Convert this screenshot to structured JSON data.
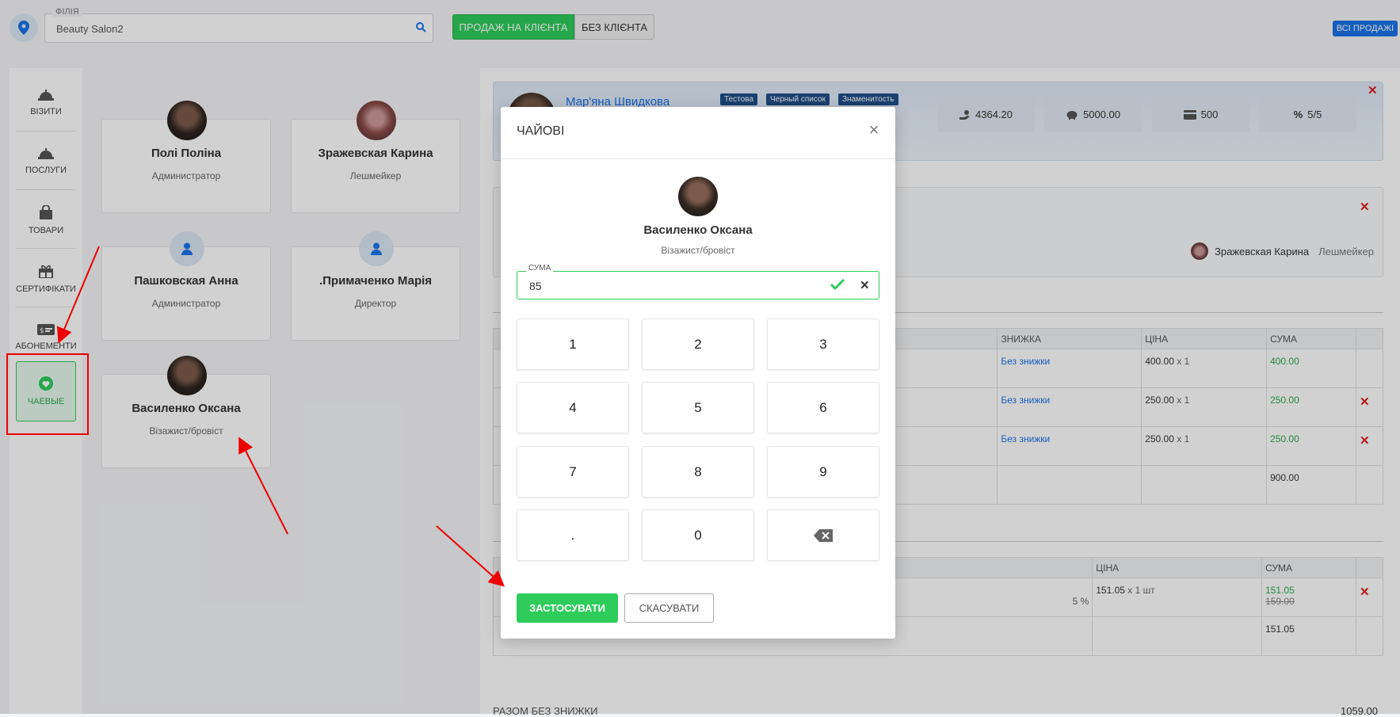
{
  "header": {
    "branch_label": "ФІЛІЯ",
    "branch_value": "Beauty Salon2",
    "sale_to_client": "ПРОДАЖ НА КЛІЄНТА",
    "no_client": "БЕЗ КЛІЄНТА",
    "all_sales": "ВСІ ПРОДАЖІ"
  },
  "sidebar": {
    "items": [
      {
        "label": "ВІЗИТИ",
        "icon": "bell-icon"
      },
      {
        "label": "ПОСЛУГИ",
        "icon": "bell-icon"
      },
      {
        "label": "ТОВАРИ",
        "icon": "bag-icon"
      },
      {
        "label": "СЕРТИФІКАТИ",
        "icon": "gift-icon"
      },
      {
        "label": "АБОНЕМЕНТИ",
        "icon": "ticket-icon"
      },
      {
        "label": "ЧАЕВЫЕ",
        "icon": "heart-icon",
        "active": true
      }
    ]
  },
  "staff": [
    {
      "name": "Полі Поліна",
      "role": "Администратор"
    },
    {
      "name": "Зражевская Карина",
      "role": "Лешмейкер"
    },
    {
      "name": "Пашковская Анна",
      "role": "Администратор"
    },
    {
      "name": ".Примаченко Марія",
      "role": "Директор"
    },
    {
      "name": "Василенко Оксана",
      "role": "Візажист/бровіст"
    }
  ],
  "client": {
    "name": "Мар'яна Швидкова",
    "tags": [
      "Тестова",
      "Черный список",
      "Знаменитость"
    ],
    "stats": [
      {
        "icon": "hand-coin-icon",
        "value": "4364.20"
      },
      {
        "icon": "piggy-bank-icon",
        "value": "5000.00"
      },
      {
        "icon": "card-icon",
        "value": "500"
      },
      {
        "icon": "percent-icon",
        "value": "5/5"
      }
    ]
  },
  "master": {
    "name": "Зражевская Карина",
    "role": "Лешмейкер"
  },
  "services_table": {
    "headers": [
      "ЗНИЖКА",
      "ЦІНА",
      "СУМА"
    ],
    "rows": [
      {
        "discount": "Без знижки",
        "price": "400.00",
        "qty": "x 1",
        "sum": "400.00"
      },
      {
        "discount": "Без знижки",
        "price": "250.00",
        "qty": "x 1",
        "sum": "250.00"
      },
      {
        "discount": "Без знижки",
        "price": "250.00",
        "qty": "x 1",
        "sum": "250.00"
      }
    ],
    "total": "900.00"
  },
  "goods_table": {
    "headers": [
      "ЦІНА",
      "СУМА"
    ],
    "row": {
      "price": "151.05",
      "qty": "x 1 шт",
      "sum": "151.05",
      "old_sum": "159.00",
      "discount_fragment": "5 %"
    },
    "total": "151.05"
  },
  "summary": {
    "label": "РАЗОМ БЕЗ ЗНИЖКИ",
    "value": "1059.00"
  },
  "modal": {
    "title": "ЧАЙОВІ",
    "employee_name": "Василенко Оксана",
    "employee_role": "Візажист/бровіст",
    "sum_label": "СУМА",
    "sum_value": "85",
    "keys": [
      "1",
      "2",
      "3",
      "4",
      "5",
      "6",
      "7",
      "8",
      "9",
      ".",
      "0"
    ],
    "apply": "ЗАСТОСУВАТИ",
    "cancel": "СКАСУВАТИ"
  },
  "colors": {
    "accent_green": "#2ecc5a",
    "accent_blue": "#1a73e8",
    "danger_red": "#e02020",
    "annotation_red": "#ee0000"
  }
}
